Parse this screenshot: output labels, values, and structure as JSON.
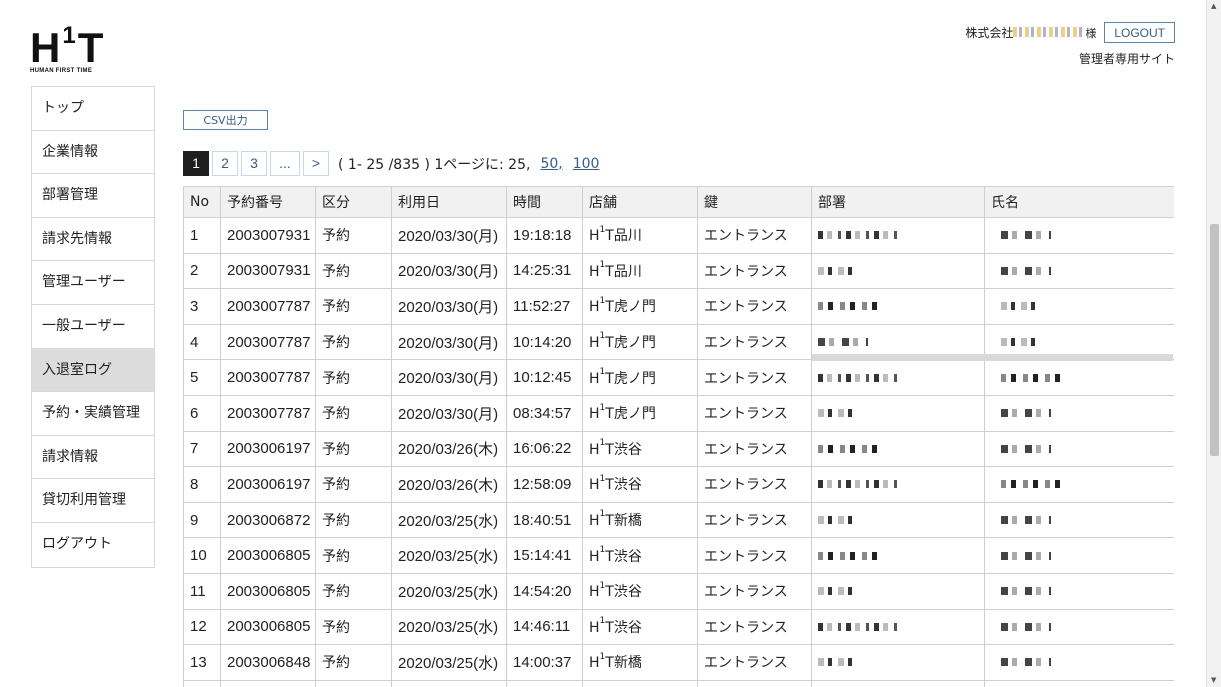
{
  "logo": {
    "mark_h": "H",
    "mark_sup": "1",
    "mark_t": "T",
    "tagline": "HUMAN FIRST TIME"
  },
  "header": {
    "company": "株式会社",
    "sama": "様",
    "logout_label": "LOGOUT",
    "admin_site": "管理者専用サイト"
  },
  "sidebar": {
    "items": [
      {
        "label": "トップ"
      },
      {
        "label": "企業情報"
      },
      {
        "label": "部署管理"
      },
      {
        "label": "請求先情報"
      },
      {
        "label": "管理ユーザー"
      },
      {
        "label": "一般ユーザー"
      },
      {
        "label": "入退室ログ",
        "active": true
      },
      {
        "label": "予約・実績管理"
      },
      {
        "label": "請求情報"
      },
      {
        "label": "貸切利用管理"
      },
      {
        "label": "ログアウト"
      }
    ]
  },
  "toolbar": {
    "csv_label": "CSV出力"
  },
  "pager": {
    "pages": [
      "1",
      "2",
      "3",
      "...",
      ">"
    ],
    "current": "1",
    "range_text": "( 1- 25 /835 )  1ページに:  25,",
    "per_page_50": "50,",
    "per_page_100": "100"
  },
  "table": {
    "headers": [
      "No",
      "予約番号",
      "区分",
      "利用日",
      "時間",
      "店舗",
      "鍵",
      "部署",
      "氏名"
    ],
    "rows": [
      {
        "no": "1",
        "id": "2003007931",
        "kind": "予約",
        "date": "2020/03/30(月)",
        "time": "19:18:18",
        "store_pre": "H",
        "store_sup": "1",
        "store_post": "T品川",
        "key": "エントランス"
      },
      {
        "no": "2",
        "id": "2003007931",
        "kind": "予約",
        "date": "2020/03/30(月)",
        "time": "14:25:31",
        "store_pre": "H",
        "store_sup": "1",
        "store_post": "T品川",
        "key": "エントランス"
      },
      {
        "no": "3",
        "id": "2003007787",
        "kind": "予約",
        "date": "2020/03/30(月)",
        "time": "11:52:27",
        "store_pre": "H",
        "store_sup": "1",
        "store_post": "T虎ノ門",
        "key": "エントランス"
      },
      {
        "no": "4",
        "id": "2003007787",
        "kind": "予約",
        "date": "2020/03/30(月)",
        "time": "10:14:20",
        "store_pre": "H",
        "store_sup": "1",
        "store_post": "T虎ノ門",
        "key": "エントランス"
      },
      {
        "no": "5",
        "id": "2003007787",
        "kind": "予約",
        "date": "2020/03/30(月)",
        "time": "10:12:45",
        "store_pre": "H",
        "store_sup": "1",
        "store_post": "T虎ノ門",
        "key": "エントランス"
      },
      {
        "no": "6",
        "id": "2003007787",
        "kind": "予約",
        "date": "2020/03/30(月)",
        "time": "08:34:57",
        "store_pre": "H",
        "store_sup": "1",
        "store_post": "T虎ノ門",
        "key": "エントランス"
      },
      {
        "no": "7",
        "id": "2003006197",
        "kind": "予約",
        "date": "2020/03/26(木)",
        "time": "16:06:22",
        "store_pre": "H",
        "store_sup": "1",
        "store_post": "T渋谷",
        "key": "エントランス"
      },
      {
        "no": "8",
        "id": "2003006197",
        "kind": "予約",
        "date": "2020/03/26(木)",
        "time": "12:58:09",
        "store_pre": "H",
        "store_sup": "1",
        "store_post": "T渋谷",
        "key": "エントランス"
      },
      {
        "no": "9",
        "id": "2003006872",
        "kind": "予約",
        "date": "2020/03/25(水)",
        "time": "18:40:51",
        "store_pre": "H",
        "store_sup": "1",
        "store_post": "T新橋",
        "key": "エントランス"
      },
      {
        "no": "10",
        "id": "2003006805",
        "kind": "予約",
        "date": "2020/03/25(水)",
        "time": "15:14:41",
        "store_pre": "H",
        "store_sup": "1",
        "store_post": "T渋谷",
        "key": "エントランス"
      },
      {
        "no": "11",
        "id": "2003006805",
        "kind": "予約",
        "date": "2020/03/25(水)",
        "time": "14:54:20",
        "store_pre": "H",
        "store_sup": "1",
        "store_post": "T渋谷",
        "key": "エントランス"
      },
      {
        "no": "12",
        "id": "2003006805",
        "kind": "予約",
        "date": "2020/03/25(水)",
        "time": "14:46:11",
        "store_pre": "H",
        "store_sup": "1",
        "store_post": "T渋谷",
        "key": "エントランス"
      },
      {
        "no": "13",
        "id": "2003006848",
        "kind": "予約",
        "date": "2020/03/25(水)",
        "time": "14:00:37",
        "store_pre": "H",
        "store_sup": "1",
        "store_post": "T新橋",
        "key": "エントランス"
      },
      {
        "no": "",
        "id": "",
        "kind": "",
        "date": "",
        "time": "",
        "store_pre": "",
        "store_sup": "",
        "store_post": "",
        "key": ""
      }
    ]
  },
  "colors": {
    "accent": "#355d86",
    "active_bg": "#dcdcdc",
    "header_bg": "#f1f1f1"
  }
}
